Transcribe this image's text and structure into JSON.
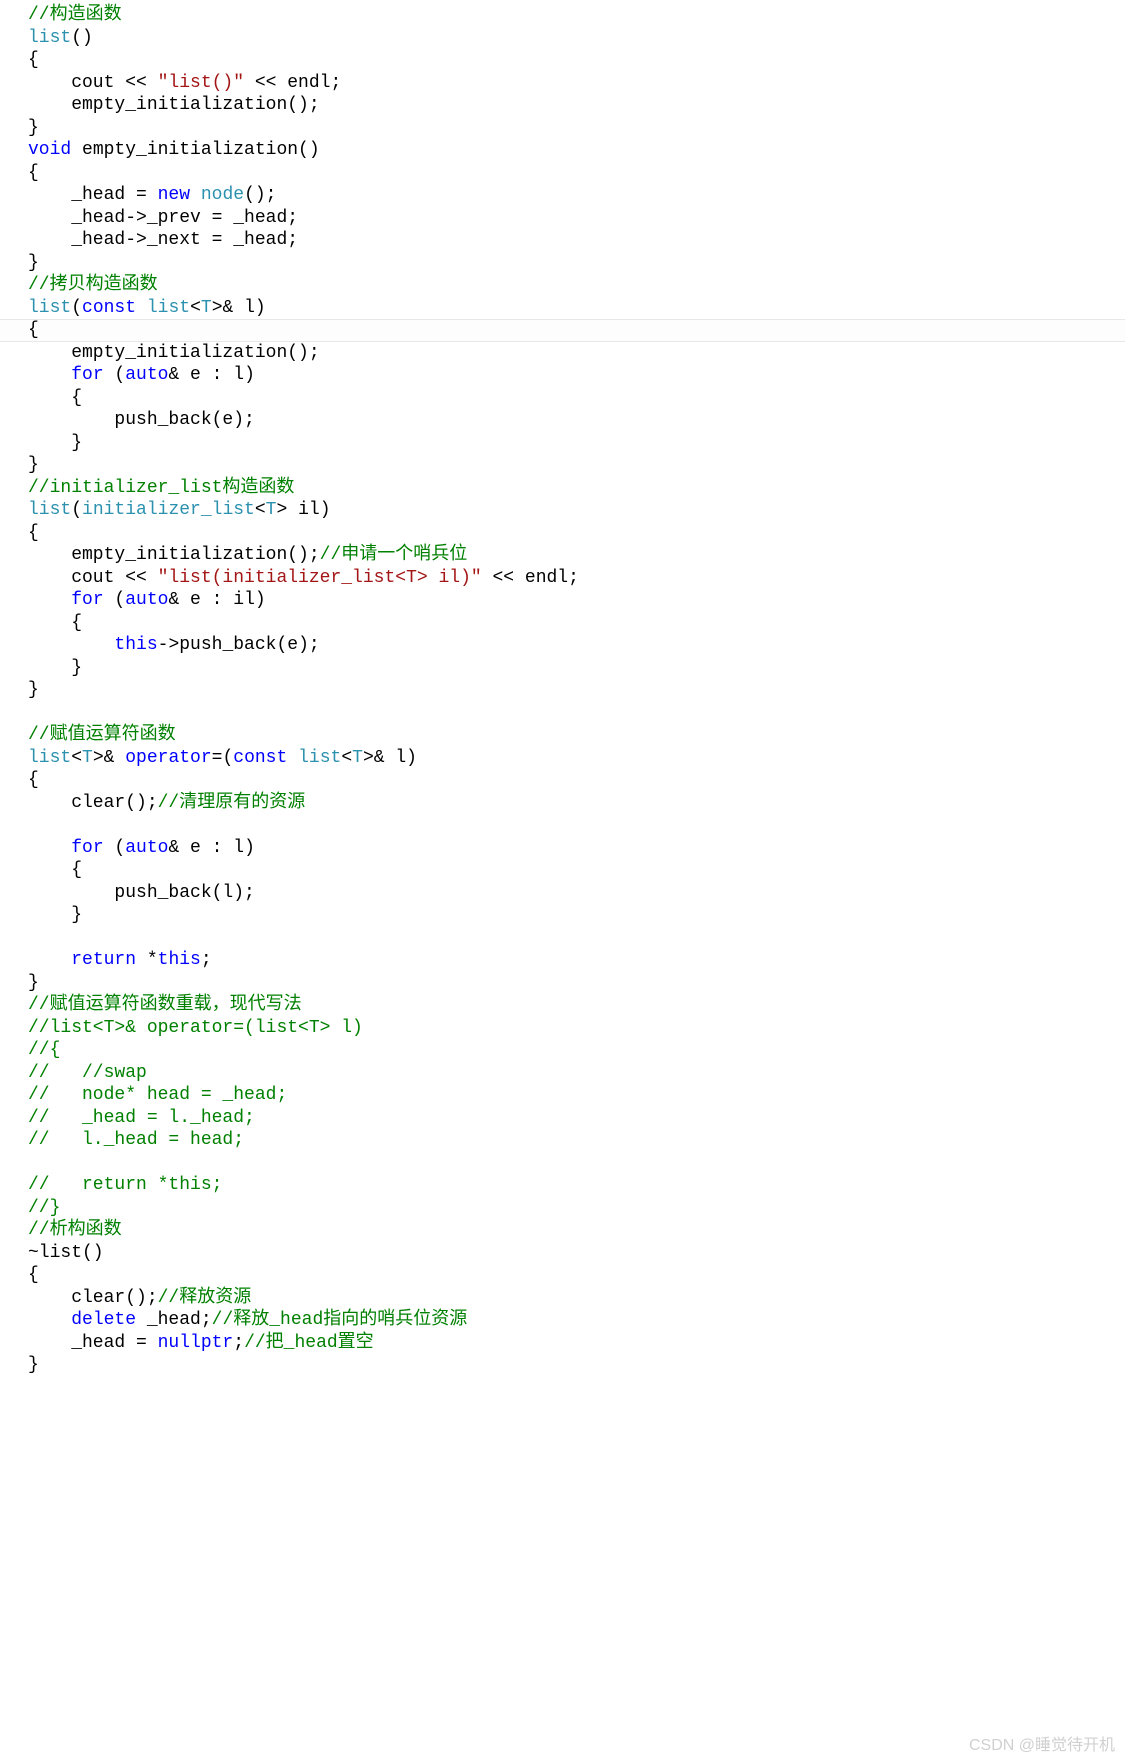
{
  "watermark": "CSDN @睡觉待开机",
  "code": {
    "tokens": [
      [
        [
          "//构造函数",
          "c-green"
        ]
      ],
      [
        [
          "list",
          "c-teal"
        ],
        [
          "()",
          "c-punc"
        ]
      ],
      [
        [
          "{",
          "c-punc"
        ]
      ],
      [
        [
          "    cout << ",
          "c-ident"
        ],
        [
          "\"list()\"",
          "c-string"
        ],
        [
          " << endl;",
          "c-ident"
        ]
      ],
      [
        [
          "    empty_initialization();",
          "c-ident"
        ]
      ],
      [
        [
          "}",
          "c-punc"
        ]
      ],
      [
        [
          "void",
          "c-blue"
        ],
        [
          " empty_initialization()",
          "c-ident"
        ]
      ],
      [
        [
          "{",
          "c-punc"
        ]
      ],
      [
        [
          "    _head = ",
          "c-ident"
        ],
        [
          "new",
          "c-blue"
        ],
        [
          " ",
          "c-ident"
        ],
        [
          "node",
          "c-teal"
        ],
        [
          "();",
          "c-punc"
        ]
      ],
      [
        [
          "    _head->_prev = _head;",
          "c-ident"
        ]
      ],
      [
        [
          "    _head->_next = _head;",
          "c-ident"
        ]
      ],
      [
        [
          "}",
          "c-punc"
        ]
      ],
      [
        [
          "//拷贝构造函数",
          "c-green"
        ]
      ],
      [
        [
          "list",
          "c-teal"
        ],
        [
          "(",
          "c-punc"
        ],
        [
          "const",
          "c-blue"
        ],
        [
          " ",
          "c-ident"
        ],
        [
          "list",
          "c-teal"
        ],
        [
          "<",
          "c-punc"
        ],
        [
          "T",
          "c-teal"
        ],
        [
          ">& l)",
          "c-punc"
        ]
      ],
      [
        [
          "{",
          "c-punc",
          "highlight"
        ]
      ],
      [
        [
          "    empty_initialization();",
          "c-ident"
        ]
      ],
      [
        [
          "    ",
          "c-ident"
        ],
        [
          "for",
          "c-blue"
        ],
        [
          " (",
          "c-punc"
        ],
        [
          "auto",
          "c-blue"
        ],
        [
          "& e : l)",
          "c-ident"
        ]
      ],
      [
        [
          "    {",
          "c-punc"
        ]
      ],
      [
        [
          "        push_back(e);",
          "c-ident"
        ]
      ],
      [
        [
          "    }",
          "c-punc"
        ]
      ],
      [
        [
          "}",
          "c-punc"
        ]
      ],
      [
        [
          "//initializer_list构造函数",
          "c-green"
        ]
      ],
      [
        [
          "list",
          "c-teal"
        ],
        [
          "(",
          "c-punc"
        ],
        [
          "initializer_list",
          "c-teal"
        ],
        [
          "<",
          "c-punc"
        ],
        [
          "T",
          "c-teal"
        ],
        [
          "> il)",
          "c-punc"
        ]
      ],
      [
        [
          "{",
          "c-punc"
        ]
      ],
      [
        [
          "    empty_initialization();",
          "c-ident"
        ],
        [
          "//申请一个哨兵位",
          "c-green"
        ]
      ],
      [
        [
          "    cout << ",
          "c-ident"
        ],
        [
          "\"list(initializer_list<T> il)\"",
          "c-string"
        ],
        [
          " << endl;",
          "c-ident"
        ]
      ],
      [
        [
          "    ",
          "c-ident"
        ],
        [
          "for",
          "c-blue"
        ],
        [
          " (",
          "c-punc"
        ],
        [
          "auto",
          "c-blue"
        ],
        [
          "& e : il)",
          "c-ident"
        ]
      ],
      [
        [
          "    {",
          "c-punc"
        ]
      ],
      [
        [
          "        ",
          "c-ident"
        ],
        [
          "this",
          "c-blue"
        ],
        [
          "->push_back(e);",
          "c-ident"
        ]
      ],
      [
        [
          "    }",
          "c-punc"
        ]
      ],
      [
        [
          "}",
          "c-punc"
        ]
      ],
      [
        [
          "",
          "c-ident"
        ]
      ],
      [
        [
          "//赋值运算符函数",
          "c-green"
        ]
      ],
      [
        [
          "list",
          "c-teal"
        ],
        [
          "<",
          "c-punc"
        ],
        [
          "T",
          "c-teal"
        ],
        [
          ">& ",
          "c-punc"
        ],
        [
          "operator",
          "c-blue"
        ],
        [
          "=(",
          "c-punc"
        ],
        [
          "const",
          "c-blue"
        ],
        [
          " ",
          "c-ident"
        ],
        [
          "list",
          "c-teal"
        ],
        [
          "<",
          "c-punc"
        ],
        [
          "T",
          "c-teal"
        ],
        [
          ">& l)",
          "c-punc"
        ]
      ],
      [
        [
          "{",
          "c-punc"
        ]
      ],
      [
        [
          "    clear();",
          "c-ident"
        ],
        [
          "//清理原有的资源",
          "c-green"
        ]
      ],
      [
        [
          "",
          "c-ident"
        ]
      ],
      [
        [
          "    ",
          "c-ident"
        ],
        [
          "for",
          "c-blue"
        ],
        [
          " (",
          "c-punc"
        ],
        [
          "auto",
          "c-blue"
        ],
        [
          "& e : l)",
          "c-ident"
        ]
      ],
      [
        [
          "    {",
          "c-punc"
        ]
      ],
      [
        [
          "        push_back(l);",
          "c-ident"
        ]
      ],
      [
        [
          "    }",
          "c-punc"
        ]
      ],
      [
        [
          "",
          "c-ident"
        ]
      ],
      [
        [
          "    ",
          "c-ident"
        ],
        [
          "return",
          "c-blue"
        ],
        [
          " *",
          "c-punc"
        ],
        [
          "this",
          "c-blue"
        ],
        [
          ";",
          "c-punc"
        ]
      ],
      [
        [
          "}",
          "c-punc"
        ]
      ],
      [
        [
          "//赋值运算符函数重载，现代写法",
          "c-green"
        ]
      ],
      [
        [
          "//list<T>& operator=(list<T> l)",
          "c-green"
        ]
      ],
      [
        [
          "//{",
          "c-green"
        ]
      ],
      [
        [
          "//   //swap",
          "c-green"
        ]
      ],
      [
        [
          "//   node* head = _head;",
          "c-green"
        ]
      ],
      [
        [
          "//   _head = l._head;",
          "c-green"
        ]
      ],
      [
        [
          "//   l._head = head;",
          "c-green"
        ]
      ],
      [
        [
          "",
          "c-ident"
        ]
      ],
      [
        [
          "//   return *this;",
          "c-green"
        ]
      ],
      [
        [
          "//}",
          "c-green"
        ]
      ],
      [
        [
          "//析构函数",
          "c-green"
        ]
      ],
      [
        [
          "~list()",
          "c-ident"
        ]
      ],
      [
        [
          "{",
          "c-punc"
        ]
      ],
      [
        [
          "    clear();",
          "c-ident"
        ],
        [
          "//释放资源",
          "c-green"
        ]
      ],
      [
        [
          "    ",
          "c-ident"
        ],
        [
          "delete",
          "c-blue"
        ],
        [
          " _head;",
          "c-ident"
        ],
        [
          "//释放_head指向的哨兵位资源",
          "c-green"
        ]
      ],
      [
        [
          "    _head = ",
          "c-ident"
        ],
        [
          "nullptr",
          "c-blue"
        ],
        [
          ";",
          "c-punc"
        ],
        [
          "//把_head置空",
          "c-green"
        ]
      ],
      [
        [
          "}",
          "c-punc"
        ]
      ]
    ]
  }
}
